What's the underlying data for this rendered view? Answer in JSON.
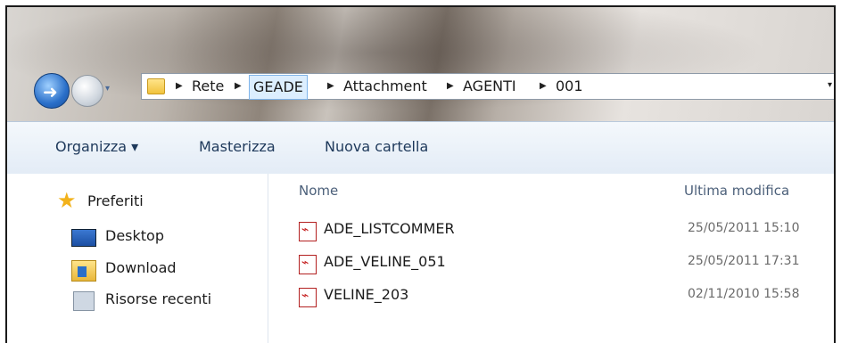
{
  "nav": {
    "back_icon": "back-arrow-icon",
    "forward_icon": "forward-arrow-icon",
    "history_dropdown": "▾"
  },
  "address": {
    "crumbs": [
      "Rete",
      "GEADE",
      "Attachment",
      "AGENTI",
      "001"
    ],
    "active_crumb": "GEADE",
    "separator": "▶",
    "dropdown": "▾"
  },
  "toolbar": {
    "organize_label": "Organizza ▾",
    "burn_label": "Masterizza",
    "new_folder_label": "Nuova cartella"
  },
  "sidebar": {
    "favorites_label": "Preferiti",
    "items": [
      {
        "label": "Desktop",
        "icon": "desktop-icon"
      },
      {
        "label": "Download",
        "icon": "download-folder-icon"
      },
      {
        "label": "Risorse recenti",
        "icon": "recent-places-icon"
      }
    ]
  },
  "content": {
    "columns": {
      "name": "Nome",
      "modified": "Ultima modifica"
    },
    "files": [
      {
        "name": "ADE_LISTCOMMER",
        "modified": "25/05/2011 15:10",
        "icon": "pdf-file-icon"
      },
      {
        "name": "ADE_VELINE_051",
        "modified": "25/05/2011 17:31",
        "icon": "pdf-file-icon"
      },
      {
        "name": "VELINE_203",
        "modified": "02/11/2010 15:58",
        "icon": "pdf-file-icon"
      }
    ]
  },
  "colors": {
    "accent": "#2a6fc9",
    "toolbar_text": "#1e395b",
    "active_crumb_bg": "#dceefe"
  }
}
